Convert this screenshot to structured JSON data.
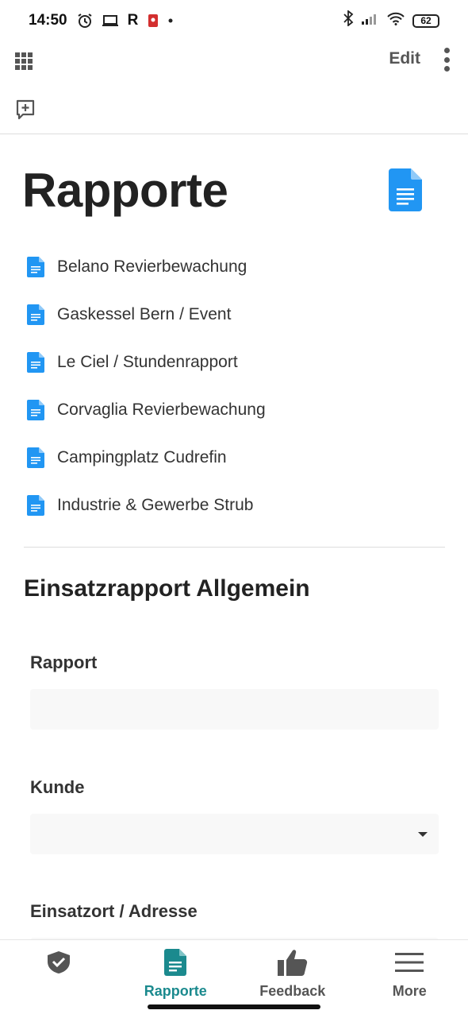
{
  "status_bar": {
    "time": "14:50",
    "notif_letter": "R",
    "battery": "62",
    "icons": [
      "alarm-icon",
      "screen-cast-icon",
      "notification-app-icon",
      "dot-icon",
      "bluetooth-icon",
      "signal-icon",
      "wifi-icon",
      "battery-icon"
    ]
  },
  "toolbar": {
    "edit_label": "Edit",
    "icons": [
      "apps-grid-icon",
      "more-vert-icon",
      "add-comment-icon"
    ]
  },
  "page": {
    "title": "Rapporte",
    "title_icon": "google-doc-icon"
  },
  "documents": [
    {
      "label": "Belano Revierbewachung"
    },
    {
      "label": "Gaskessel Bern / Event"
    },
    {
      "label": "Le Ciel / Stundenrapport"
    },
    {
      "label": "Corvaglia Revierbewachung"
    },
    {
      "label": "Campingplatz Cudrefin"
    },
    {
      "label": "Industrie & Gewerbe Strub"
    }
  ],
  "form": {
    "title": "Einsatzrapport Allgemein",
    "fields": [
      {
        "label": "Rapport",
        "value": "",
        "type": "text"
      },
      {
        "label": "Kunde",
        "value": "",
        "type": "dropdown"
      },
      {
        "label": "Einsatzort / Adresse",
        "value": "",
        "type": "text"
      }
    ]
  },
  "bottom_nav": {
    "tabs": [
      {
        "label": "",
        "icon": "shield-check-icon",
        "active": false
      },
      {
        "label": "Rapporte",
        "icon": "document-icon",
        "active": true
      },
      {
        "label": "Feedback",
        "icon": "thumbs-up-icon",
        "active": false
      },
      {
        "label": "More",
        "icon": "menu-icon",
        "active": false
      }
    ]
  },
  "colors": {
    "accent": "#1b8a8e",
    "doc_blue": "#2196f3",
    "field_bg": "#f8f8f8"
  }
}
